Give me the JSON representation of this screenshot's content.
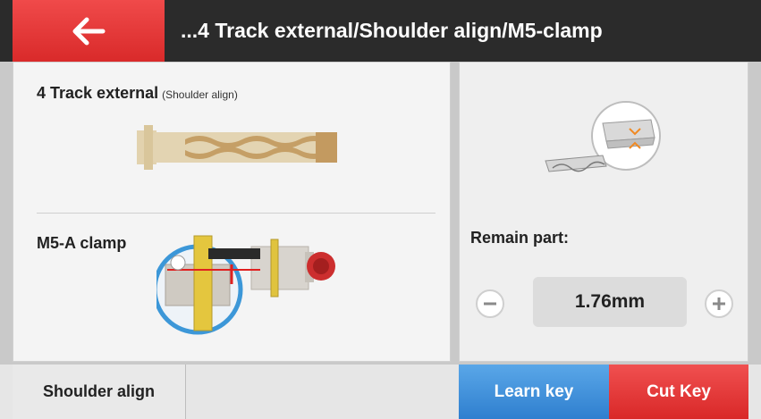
{
  "header": {
    "back_icon": "arrow-left-icon",
    "title": "...4 Track external/Shoulder align/M5-clamp"
  },
  "key_panel": {
    "key_title": "4 Track external",
    "key_subtitle": "(Shoulder align)",
    "key_image": "key-blank-4-track-external",
    "clamp_label": "M5-A clamp",
    "clamp_image": "m5-a-clamp-shoulder-align"
  },
  "cut_panel": {
    "illustration": "key-cut-depth-detail",
    "remain_label": "Remain part:",
    "remain_value": "1.76mm",
    "minus_icon": "minus-icon",
    "plus_icon": "plus-icon"
  },
  "footer": {
    "shoulder_label": "Shoulder align",
    "learn_label": "Learn key",
    "cut_label": "Cut Key"
  },
  "colors": {
    "header_bg": "#2b2b2b",
    "back_red": "#e53535",
    "learn_blue": "#3b8ad8",
    "cut_red": "#e03030",
    "key_gold": "#ddc99f"
  }
}
